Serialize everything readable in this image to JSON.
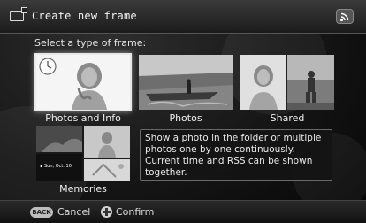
{
  "header": {
    "title": "Create new frame",
    "left_icon": "frame-add-icon",
    "right_icon": "wireless-icon"
  },
  "section_label": "Select a type of frame:",
  "frame_types": [
    {
      "label": "Photos and Info",
      "selected": true
    },
    {
      "label": "Photos",
      "selected": false
    },
    {
      "label": "Shared",
      "selected": false
    },
    {
      "label": "Memories",
      "selected": false
    }
  ],
  "memories_caption": "Sun, Oct. 10",
  "description": "Show a photo in the folder or multiple photos one by one continuously. Current time and RSS can be shown together.",
  "footer": {
    "back_badge": "BACK",
    "cancel_label": "Cancel",
    "confirm_label": "Confirm"
  }
}
